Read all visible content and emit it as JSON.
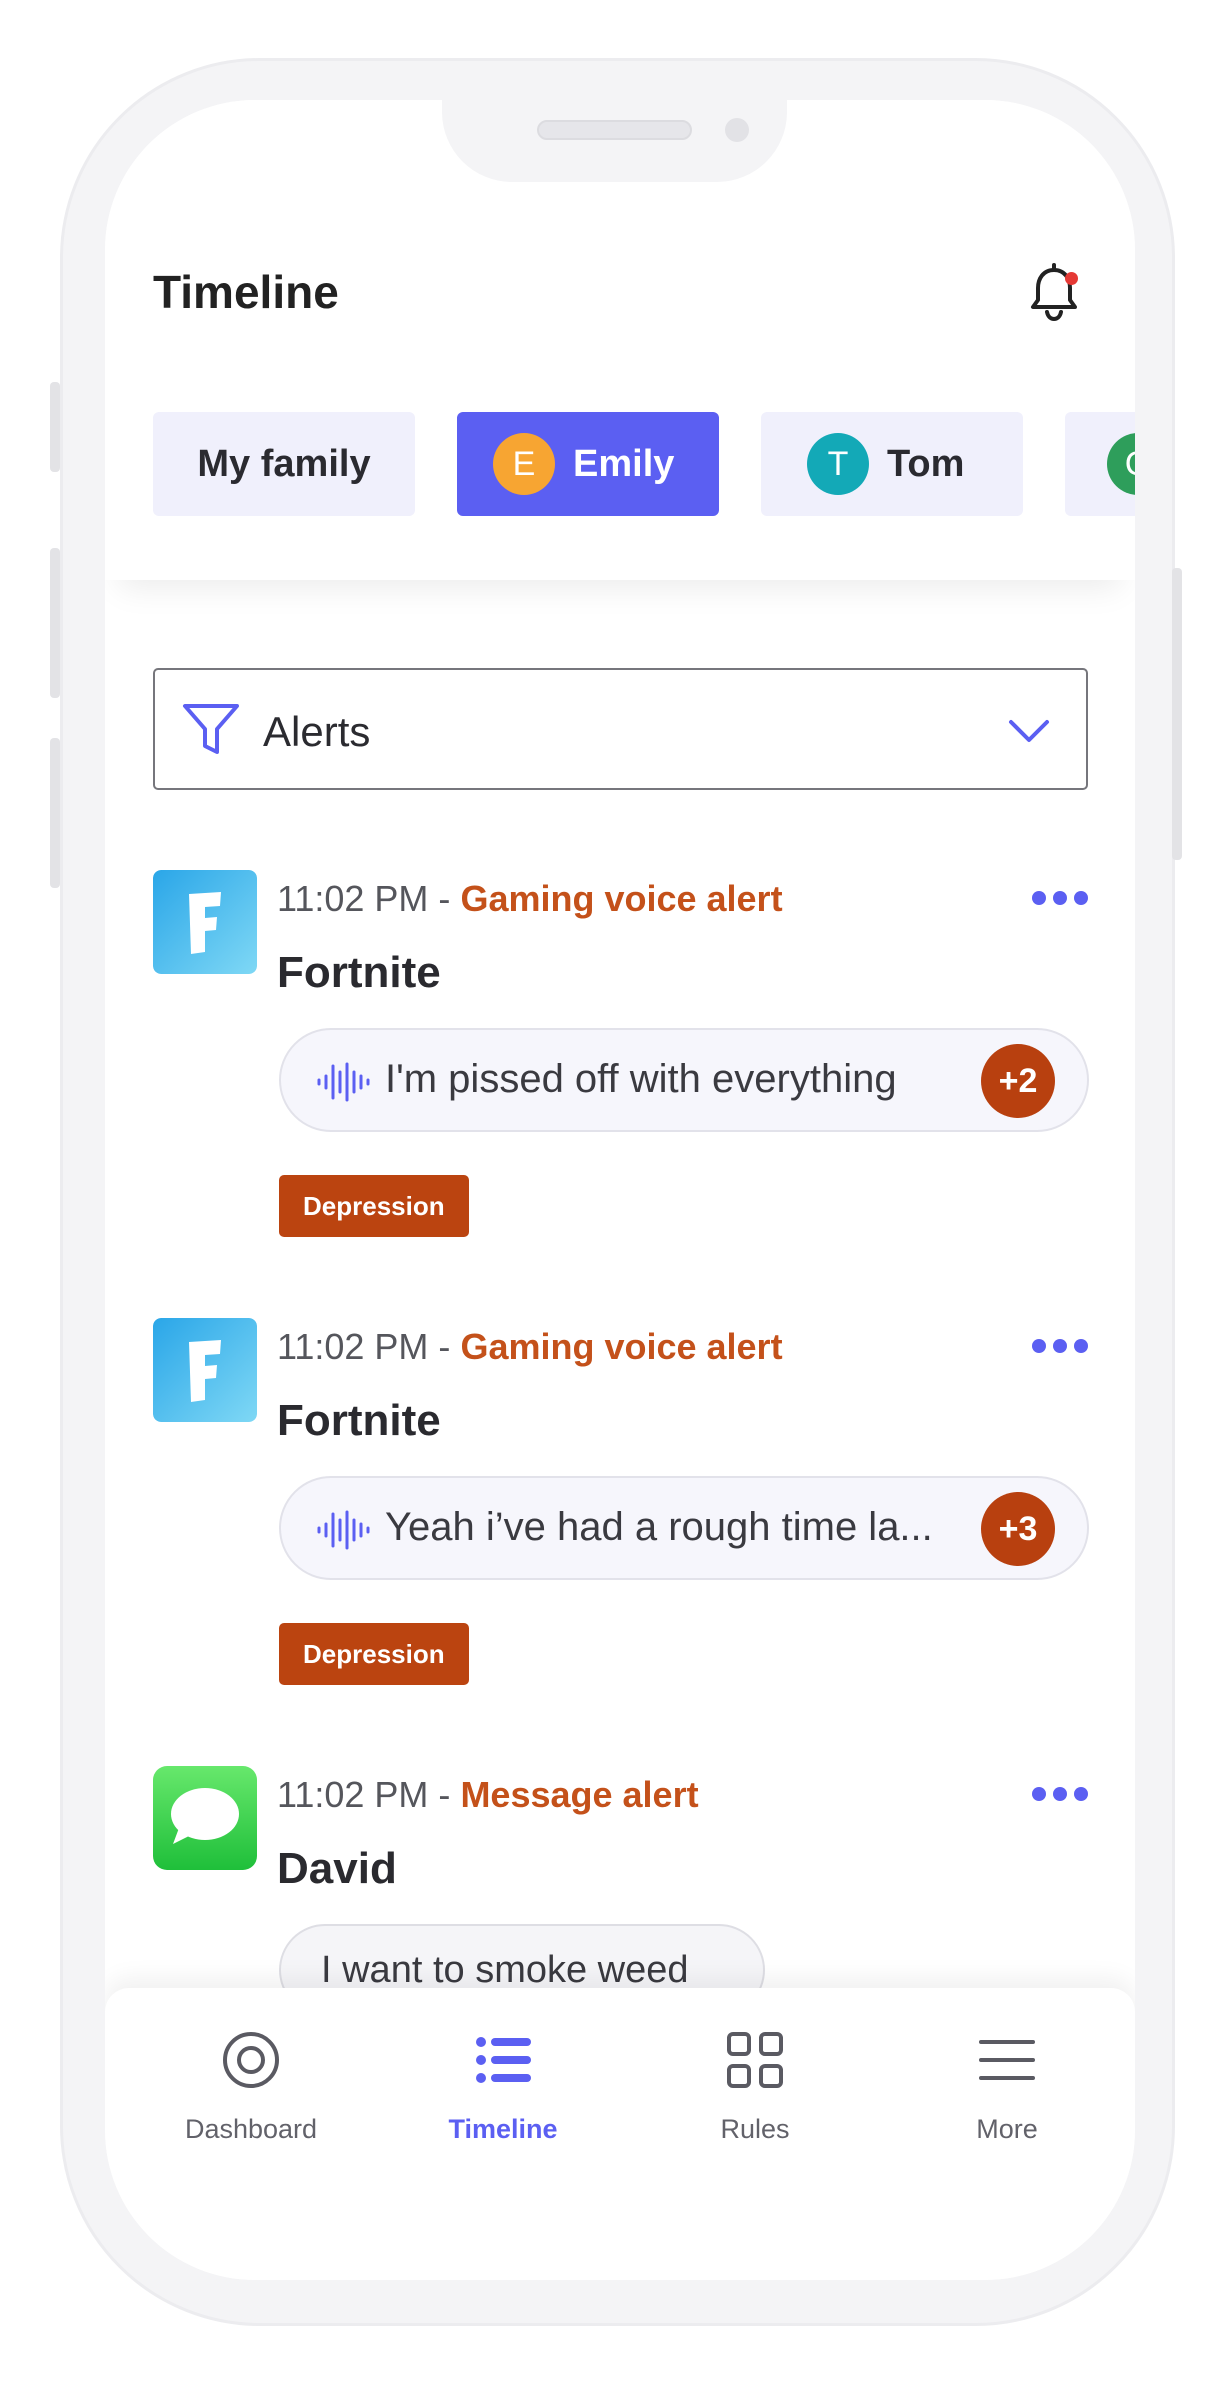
{
  "header": {
    "title": "Timeline",
    "bell_icon": "notification-bell-icon"
  },
  "members": [
    {
      "label": "My family",
      "initial": "",
      "color": ""
    },
    {
      "label": "Emily",
      "initial": "E",
      "color": "#f7a532"
    },
    {
      "label": "Tom",
      "initial": "T",
      "color": "#13a9b7"
    },
    {
      "label": "",
      "initial": "G",
      "color": "#2e9e5b"
    }
  ],
  "filter": {
    "label": "Alerts"
  },
  "alerts": [
    {
      "time": "11:02 PM -",
      "type": "Gaming voice alert",
      "source": "Fortnite",
      "content": "I'm pissed off with everything",
      "count": "+2",
      "tag": "Depression"
    },
    {
      "time": "11:02 PM -",
      "type": "Gaming voice alert",
      "source": "Fortnite",
      "content": "Yeah i’ve had a rough time la...",
      "count": "+3",
      "tag": "Depression"
    },
    {
      "time": "11:02 PM -",
      "type": "Message alert",
      "source": "David",
      "content": "I want to smoke weed"
    }
  ],
  "tabs": [
    {
      "label": "Dashboard",
      "icon": "target-icon"
    },
    {
      "label": "Timeline",
      "icon": "list-icon"
    },
    {
      "label": "Rules",
      "icon": "grid-icon"
    },
    {
      "label": "More",
      "icon": "menu-icon"
    }
  ],
  "colors": {
    "accent": "#5b5ff2",
    "alert_type": "#c4511a",
    "tag_bg": "#bb4410",
    "chip_bg": "#f0f0fc"
  }
}
